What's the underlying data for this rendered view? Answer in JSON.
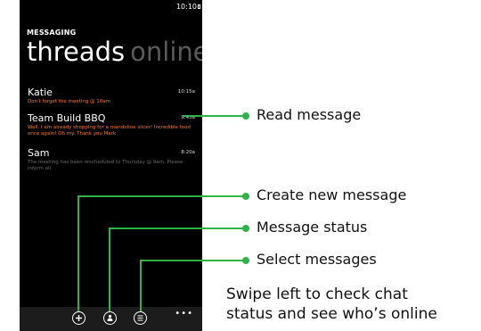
{
  "phone": {
    "status_time": "10:10",
    "app_title": "MESSAGING",
    "pivot_active": "threads",
    "pivot_inactive": "online",
    "threads": [
      {
        "name": "Katie",
        "time": "10:15a",
        "preview": "Don't forget the meeting @ 10am",
        "unread": true
      },
      {
        "name": "Team Build BBQ",
        "time": "9:45a",
        "preview": "Well, I am already shopping for a mandoline slicer! Incredible food once again! Oh my. Thank you Mark",
        "unread": true
      },
      {
        "name": "Sam",
        "time": "8:20a",
        "preview": "The meeting has been rescheduled to Thursday @ 9am. Please inform all.",
        "unread": false
      }
    ],
    "appbar": {
      "buttons": [
        {
          "name": "new-message-button",
          "icon": "plus-icon"
        },
        {
          "name": "status-button",
          "icon": "person-icon"
        },
        {
          "name": "select-button",
          "icon": "list-icon"
        }
      ],
      "more": "•••"
    }
  },
  "callouts": {
    "read_message": "Read message",
    "create_new_message": "Create new message",
    "message_status": "Message status",
    "select_messages": "Select messages",
    "swipe_line1": "Swipe left to check chat",
    "swipe_line2": "status and see who’s online"
  },
  "colors": {
    "accent": "#ff7a18",
    "callout_green": "#2db34a",
    "phone_bg": "#000000"
  }
}
